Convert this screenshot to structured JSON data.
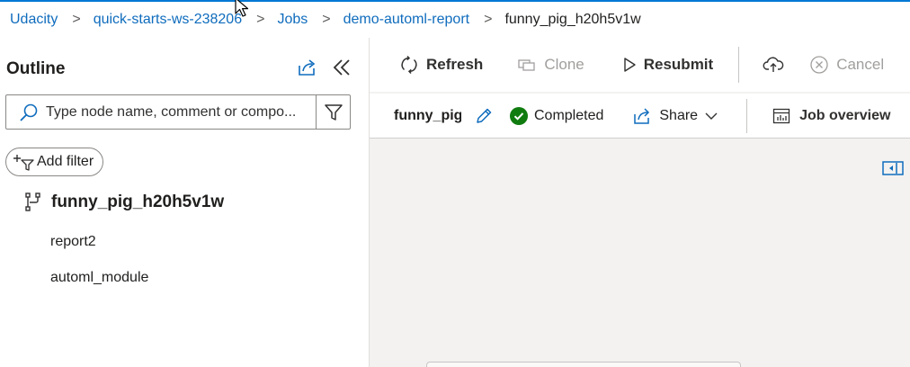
{
  "breadcrumb": {
    "items": [
      "Udacity",
      "quick-starts-ws-238206",
      "Jobs",
      "demo-automl-report"
    ],
    "current": "funny_pig_h20h5v1w",
    "separator": ">"
  },
  "outline": {
    "title": "Outline",
    "search_placeholder": "Type node name, comment or compo...",
    "add_filter_label": "Add filter",
    "tree": {
      "root_label": "funny_pig_h20h5v1w",
      "children": [
        "report2",
        "automl_module"
      ]
    }
  },
  "toolbar": {
    "refresh_label": "Refresh",
    "clone_label": "Clone",
    "resubmit_label": "Resubmit",
    "cancel_label": "Cancel"
  },
  "jobbar": {
    "job_name": "funny_pig",
    "status": "Completed",
    "share_label": "Share",
    "overview_label": "Job overview"
  },
  "colors": {
    "link": "#0f6cbd",
    "accent": "#0078d4",
    "success": "#107c10",
    "disabled": "#a19f9d"
  },
  "icons": [
    "popout-icon",
    "double-chevron-left-icon",
    "search-icon",
    "funnel-icon",
    "pipeline-icon",
    "refresh-icon",
    "clone-icon",
    "play-icon",
    "cloud-upload-icon",
    "cancel-icon",
    "pencil-icon",
    "checkmark-circle-icon",
    "share-icon",
    "chevron-down-icon",
    "dashboard-icon",
    "panel-expand-icon"
  ]
}
